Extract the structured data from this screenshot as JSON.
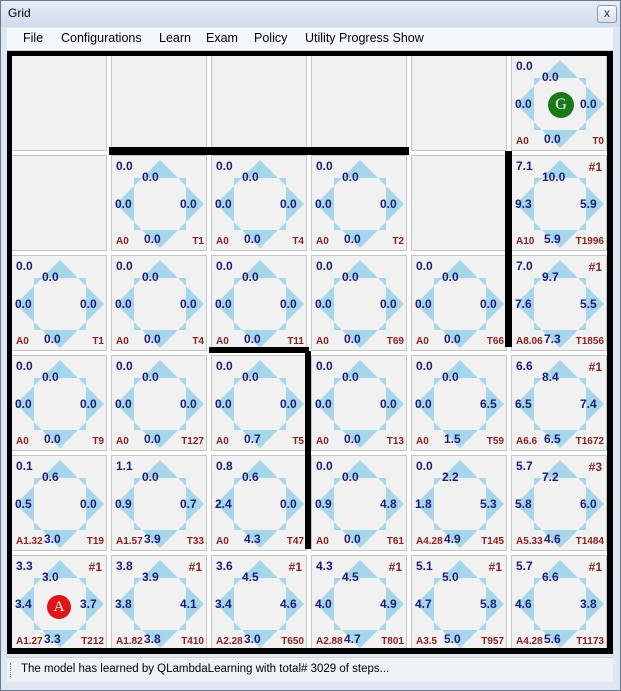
{
  "window": {
    "title": "Grid",
    "close_glyph": "x"
  },
  "menu": [
    "File",
    "Configurations",
    "Learn",
    "Exam",
    "Policy",
    "Utility Progress Show"
  ],
  "colors": {
    "arrow": "#a6d6ea",
    "qvalue": "#1b1b7a",
    "label": "#8b2222",
    "goal": "#1a7a1a",
    "agent": "#e01515"
  },
  "grid": {
    "rows": [
      [
        {
          "type": "empty"
        },
        {
          "type": "empty"
        },
        {
          "type": "empty"
        },
        {
          "type": "empty"
        },
        {
          "type": "empty"
        },
        {
          "type": "goal",
          "tl": "0.0",
          "up": "0.0",
          "left": "0.0",
          "right": "0.0",
          "down": "0.0",
          "a": "A0",
          "t": "T0",
          "marker": "G"
        }
      ],
      [
        {
          "type": "empty"
        },
        {
          "type": "state",
          "tl": "0.0",
          "up": "0.0",
          "left": "0.0",
          "right": "0.0",
          "down": "0.0",
          "a": "A0",
          "t": "T1"
        },
        {
          "type": "state",
          "tl": "0.0",
          "up": "0.0",
          "left": "0.0",
          "right": "0.0",
          "down": "0.0",
          "a": "A0",
          "t": "T4"
        },
        {
          "type": "state",
          "tl": "0.0",
          "up": "0.0",
          "left": "0.0",
          "right": "0.0",
          "down": "0.0",
          "a": "A0",
          "t": "T2"
        },
        {
          "type": "empty"
        },
        {
          "type": "state",
          "tl": "7.1",
          "up": "10.0",
          "left": "9.3",
          "right": "5.9",
          "down": "5.9",
          "a": "A10",
          "t": "T1996",
          "ex": "#1"
        }
      ],
      [
        {
          "type": "state",
          "tl": "0.0",
          "up": "0.0",
          "left": "0.0",
          "right": "0.0",
          "down": "0.0",
          "a": "A0",
          "t": "T1"
        },
        {
          "type": "state",
          "tl": "0.0",
          "up": "0.0",
          "left": "0.0",
          "right": "0.0",
          "down": "0.0",
          "a": "A0",
          "t": "T4"
        },
        {
          "type": "state",
          "tl": "0.0",
          "up": "0.0",
          "left": "0.0",
          "right": "0.0",
          "down": "0.0",
          "a": "A0",
          "t": "T11"
        },
        {
          "type": "state",
          "tl": "0.0",
          "up": "0.0",
          "left": "0.0",
          "right": "0.0",
          "down": "0.0",
          "a": "A0",
          "t": "T69"
        },
        {
          "type": "state",
          "tl": "0.0",
          "up": "0.0",
          "left": "0.0",
          "right": "0.0",
          "down": "0.0",
          "a": "A0",
          "t": "T66"
        },
        {
          "type": "state",
          "tl": "7.0",
          "up": "9.7",
          "left": "7.6",
          "right": "5.5",
          "down": "7.3",
          "a": "A8.06",
          "t": "T1856",
          "ex": "#1"
        }
      ],
      [
        {
          "type": "state",
          "tl": "0.0",
          "up": "0.0",
          "left": "0.0",
          "right": "0.0",
          "down": "0.0",
          "a": "A0",
          "t": "T9"
        },
        {
          "type": "state",
          "tl": "0.0",
          "up": "0.0",
          "left": "0.0",
          "right": "0.0",
          "down": "0.0",
          "a": "A0",
          "t": "T127"
        },
        {
          "type": "state",
          "tl": "0.0",
          "up": "0.0",
          "left": "0.0",
          "right": "0.0",
          "down": "0.7",
          "a": "A0",
          "t": "T5"
        },
        {
          "type": "state",
          "tl": "0.0",
          "up": "0.0",
          "left": "0.0",
          "right": "0.0",
          "down": "0.0",
          "a": "A0",
          "t": "T13"
        },
        {
          "type": "state",
          "tl": "0.0",
          "up": "0.0",
          "left": "0.0",
          "right": "6.5",
          "down": "1.5",
          "a": "A0",
          "t": "T59"
        },
        {
          "type": "state",
          "tl": "6.6",
          "up": "8.4",
          "left": "6.5",
          "right": "7.4",
          "down": "6.5",
          "a": "A6.6",
          "t": "T1672",
          "ex": "#1"
        }
      ],
      [
        {
          "type": "state",
          "tl": "0.1",
          "up": "0.6",
          "left": "0.5",
          "right": "0.0",
          "down": "3.0",
          "a": "A1.32",
          "t": "T19"
        },
        {
          "type": "state",
          "tl": "1.1",
          "up": "0.0",
          "left": "0.9",
          "right": "0.7",
          "down": "3.9",
          "a": "A1.57",
          "t": "T33"
        },
        {
          "type": "state",
          "tl": "0.8",
          "up": "0.6",
          "left": "2.4",
          "right": "0.0",
          "down": "4.3",
          "a": "A0",
          "t": "T47"
        },
        {
          "type": "state",
          "tl": "0.0",
          "up": "0.0",
          "left": "0.9",
          "right": "4.8",
          "down": "0.0",
          "a": "A0",
          "t": "T61"
        },
        {
          "type": "state",
          "tl": "0.0",
          "up": "2.2",
          "left": "1.8",
          "right": "5.3",
          "down": "4.9",
          "a": "A4.28",
          "t": "T145"
        },
        {
          "type": "state",
          "tl": "5.7",
          "up": "7.2",
          "left": "5.8",
          "right": "6.0",
          "down": "4.6",
          "a": "A5.33",
          "t": "T1484",
          "ex": "#3"
        }
      ],
      [
        {
          "type": "agent",
          "tl": "3.3",
          "up": "3.0",
          "left": "3.4",
          "right": "3.7",
          "down": "3.3",
          "a": "A1.27",
          "t": "T212",
          "ex": "#1",
          "marker": "A"
        },
        {
          "type": "state",
          "tl": "3.8",
          "up": "3.9",
          "left": "3.8",
          "right": "4.1",
          "down": "3.8",
          "a": "A1.82",
          "t": "T410",
          "ex": "#1"
        },
        {
          "type": "state",
          "tl": "3.6",
          "up": "4.5",
          "left": "3.4",
          "right": "4.6",
          "down": "3.0",
          "a": "A2.28",
          "t": "T650",
          "ex": "#1"
        },
        {
          "type": "state",
          "tl": "4.3",
          "up": "4.5",
          "left": "4.0",
          "right": "4.9",
          "down": "4.7",
          "a": "A2.88",
          "t": "T801",
          "ex": "#1"
        },
        {
          "type": "state",
          "tl": "5.1",
          "up": "5.0",
          "left": "4.7",
          "right": "5.8",
          "down": "5.0",
          "a": "A3.5",
          "t": "T957",
          "ex": "#1"
        },
        {
          "type": "state",
          "tl": "5.7",
          "up": "6.6",
          "left": "4.6",
          "right": "3.8",
          "down": "5.6",
          "a": "A4.28",
          "t": "T1173",
          "ex": "#1"
        }
      ]
    ]
  },
  "status": {
    "text": "The model has learned by QLambdaLearning with total# 3029 of steps..."
  }
}
